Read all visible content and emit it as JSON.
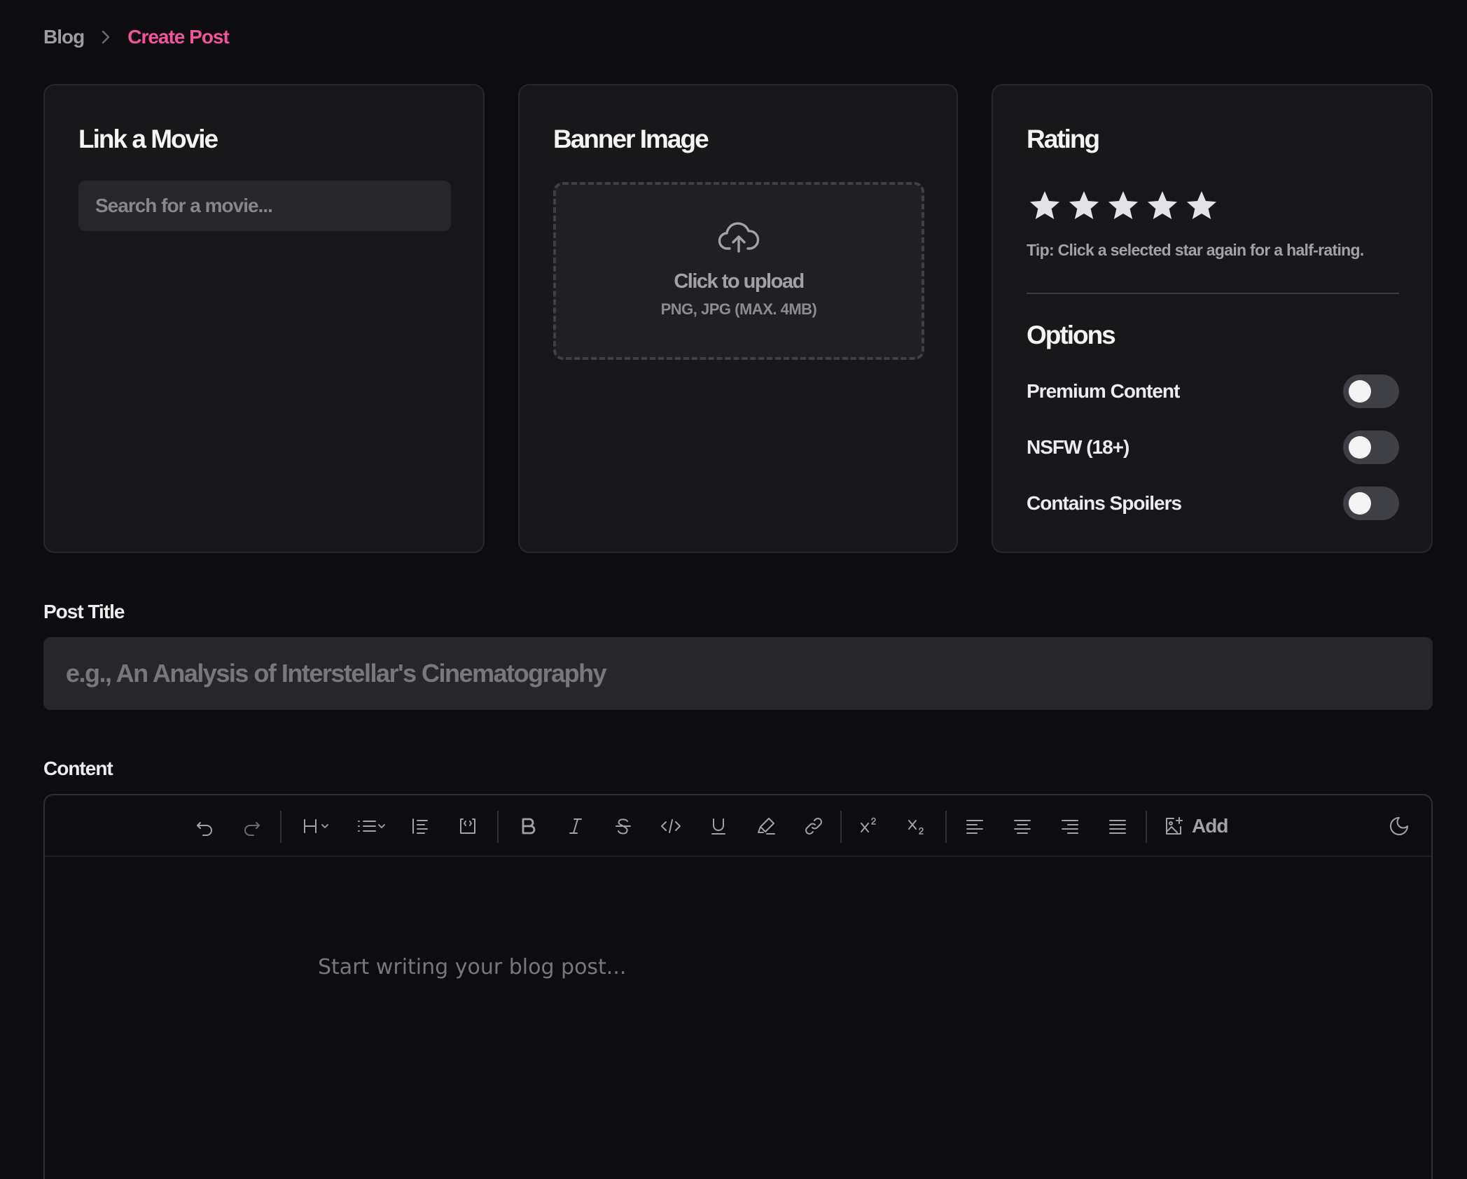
{
  "breadcrumb": {
    "parent": "Blog",
    "current": "Create Post"
  },
  "colors": {
    "accent": "#f2549b",
    "card_bg": "#18181b",
    "page_bg": "#0d0d0f",
    "input_bg": "#27272a"
  },
  "link_movie": {
    "title": "Link a Movie",
    "search_placeholder": "Search for a movie...",
    "search_value": ""
  },
  "banner": {
    "title": "Banner Image",
    "upload_label": "Click to upload",
    "upload_hint": "PNG, JPG (MAX. 4MB)",
    "icon": "cloud-upload-icon"
  },
  "rating": {
    "title": "Rating",
    "value": 0,
    "max": 5,
    "tip": "Tip: Click a selected star again for a half-rating."
  },
  "options": {
    "title": "Options",
    "items": [
      {
        "label": "Premium Content",
        "enabled": false
      },
      {
        "label": "NSFW (18+)",
        "enabled": false
      },
      {
        "label": "Contains Spoilers",
        "enabled": false
      }
    ]
  },
  "post_title": {
    "label": "Post Title",
    "placeholder": "e.g., An Analysis of Interstellar's Cinematography",
    "value": ""
  },
  "content": {
    "label": "Content",
    "placeholder": "Start writing your blog post...",
    "toolbar": {
      "add_label": "Add",
      "buttons": [
        "undo-icon",
        "redo-icon",
        "heading-icon",
        "list-icon",
        "blockquote-icon",
        "code-block-icon",
        "bold-icon",
        "italic-icon",
        "strikethrough-icon",
        "code-icon",
        "underline-icon",
        "highlight-icon",
        "link-icon",
        "superscript-icon",
        "subscript-icon",
        "align-left-icon",
        "align-center-icon",
        "align-right-icon",
        "align-justify-icon",
        "image-add-icon",
        "theme-toggle-icon"
      ]
    }
  }
}
